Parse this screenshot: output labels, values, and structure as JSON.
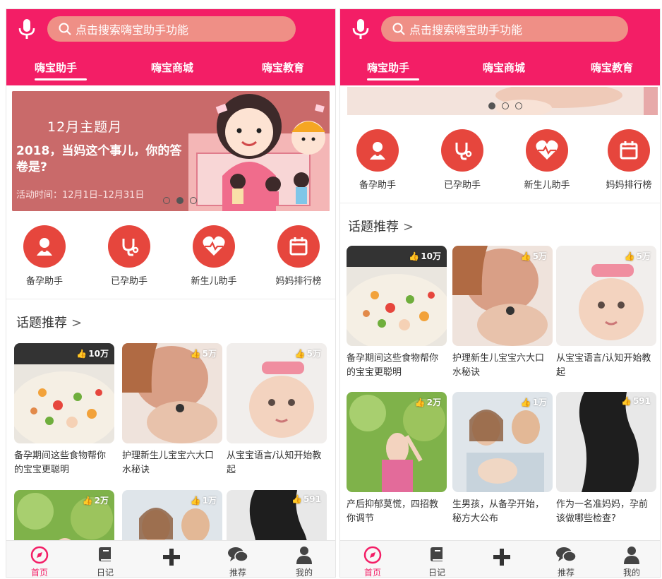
{
  "search": {
    "placeholder": "点击搜索嗨宝助手功能"
  },
  "tabs": [
    "嗨宝助手",
    "嗨宝商城",
    "嗨宝教育"
  ],
  "banner": {
    "title": "12月主题月",
    "subtitle": "2018，当妈这个事儿，你的答卷是?",
    "date": "活动时间：12月1日–12月31日"
  },
  "quick_icons": [
    {
      "label": "备孕助手",
      "icon": "baby-icon"
    },
    {
      "label": "已孕助手",
      "icon": "stethoscope-icon"
    },
    {
      "label": "新生儿助手",
      "icon": "heartbeat-icon"
    },
    {
      "label": "妈妈排行榜",
      "icon": "calendar-icon"
    }
  ],
  "section_title": "话题推荐",
  "topics": [
    {
      "caption": "备孕期间这些食物帮你的宝宝更聪明",
      "likes": "10万"
    },
    {
      "caption": "护理新生儿宝宝六大口水秘诀",
      "likes": "5万"
    },
    {
      "caption": "从宝宝语言/认知开始教起",
      "likes": "5万"
    },
    {
      "caption": "产后抑郁莫慌，四招教你调节",
      "likes": "2万"
    },
    {
      "caption": "生男孩，从备孕开始，秘方大公布",
      "likes": "1万"
    },
    {
      "caption": "作为一名准妈妈，孕前该做哪些检查?",
      "likes": "591"
    }
  ],
  "bottom_nav": [
    {
      "label": "首页",
      "icon": "compass-icon",
      "active": true
    },
    {
      "label": "日记",
      "icon": "book-icon"
    },
    {
      "label": "",
      "icon": "plus-icon"
    },
    {
      "label": "推荐",
      "icon": "chat-icon"
    },
    {
      "label": "我的",
      "icon": "person-icon"
    }
  ],
  "colors": {
    "brand": "#f31e66",
    "icon_red": "#e6463d",
    "search_bg": "#ef8f86"
  }
}
